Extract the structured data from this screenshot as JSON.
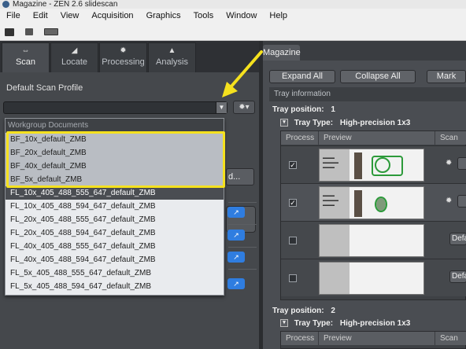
{
  "window": {
    "title": "Magazine - ZEN 2.6 slidescan"
  },
  "menu": [
    "File",
    "Edit",
    "View",
    "Acquisition",
    "Graphics",
    "Tools",
    "Window",
    "Help"
  ],
  "toolbar": {
    "icons": [
      "folder-open-icon",
      "save-icon",
      "keyboard-icon"
    ]
  },
  "left_tabs": [
    {
      "label": "Scan",
      "icon": "scan-icon",
      "active": true
    },
    {
      "label": "Locate",
      "icon": "locate-icon",
      "active": false
    },
    {
      "label": "Processing",
      "icon": "processing-icon",
      "active": false
    },
    {
      "label": "Analysis",
      "icon": "analysis-icon",
      "active": false
    }
  ],
  "scan": {
    "profile_label": "Default Scan Profile",
    "profile_value": "",
    "partial_button": "d..."
  },
  "dropdown": {
    "header": "Workgroup Documents",
    "items": [
      "BF_10x_default_ZMB",
      "BF_20x_default_ZMB",
      "BF_40x_default_ZMB",
      "BF_5x_default_ZMB",
      "FL_10x_405_488_555_647_default_ZMB",
      "FL_10x_405_488_594_647_default_ZMB",
      "FL_20x_405_488_555_647_default_ZMB",
      "FL_20x_405_488_594_647_default_ZMB",
      "FL_40x_405_488_555_647_default_ZMB",
      "FL_40x_405_488_594_647_default_ZMB",
      "FL_5x_405_488_555_647_default_ZMB",
      "FL_5x_405_488_594_647_default_ZMB"
    ]
  },
  "magazine": {
    "tab_label": "Magazine",
    "expand_all": "Expand All",
    "collapse_all": "Collapse All",
    "mark": "Mark",
    "tray_info": "Tray information",
    "trays": [
      {
        "position_label": "Tray position:",
        "position": "1",
        "type_label": "Tray Type:",
        "type": "High-precision 1x3",
        "columns": [
          "Process",
          "Preview",
          "Scan"
        ],
        "rows": [
          {
            "checked": true,
            "button": ""
          },
          {
            "checked": true,
            "button": ""
          },
          {
            "checked": false,
            "button": "Defa"
          },
          {
            "checked": false,
            "button": "Defa"
          }
        ]
      },
      {
        "position_label": "Tray position:",
        "position": "2",
        "type_label": "Tray Type:",
        "type": "High-precision 1x3",
        "columns": [
          "Process",
          "Preview",
          "Scan"
        ]
      }
    ]
  },
  "colors": {
    "highlight_box": "#f5e11e",
    "accent_blue": "#2f7de0",
    "arrow": "#f5e11e"
  }
}
